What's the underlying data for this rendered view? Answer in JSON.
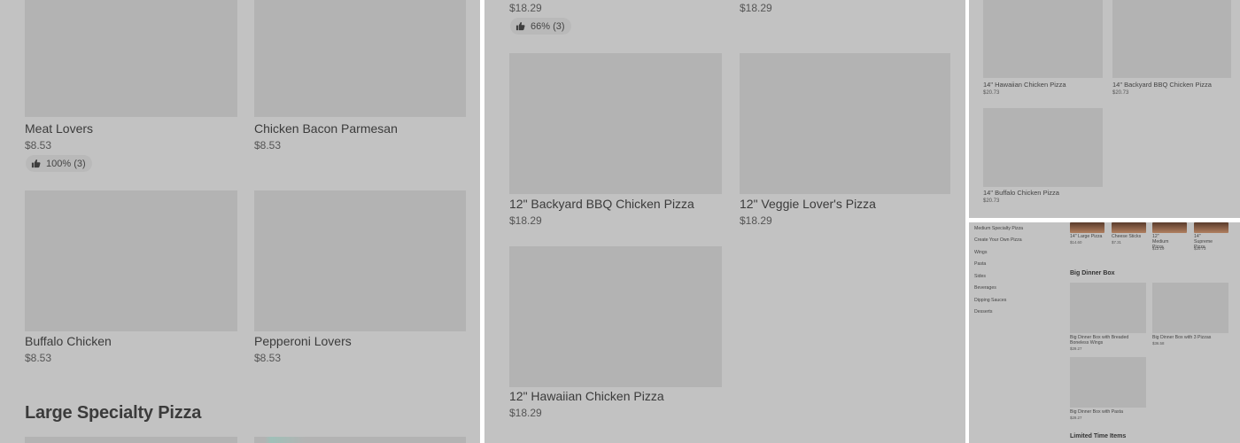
{
  "panel_1": {
    "items": [
      {
        "name": "Meat Lovers",
        "price": "$8.53",
        "rating": "100% (3)"
      },
      {
        "name": "Chicken Bacon Parmesan",
        "price": "$8.53"
      },
      {
        "name": "Buffalo Chicken",
        "price": "$8.53"
      },
      {
        "name": "Pepperoni Lovers",
        "price": "$8.53"
      }
    ],
    "section_title": "Large Specialty Pizza"
  },
  "panel_2": {
    "top_prices": [
      "$18.29",
      "$18.29"
    ],
    "top_rating": "66% (3)",
    "items": [
      {
        "name": "12\" Backyard BBQ Chicken Pizza",
        "price": "$18.29"
      },
      {
        "name": "12\" Veggie Lover's Pizza",
        "price": "$18.29"
      },
      {
        "name": "12\" Hawaiian Chicken Pizza",
        "price": "$18.29"
      }
    ]
  },
  "panel_3": {
    "items": [
      {
        "name": "14\" Hawaiian Chicken Pizza",
        "price": "$20.73"
      },
      {
        "name": "14\" Backyard BBQ Chicken Pizza",
        "price": "$20.73"
      },
      {
        "name": "14\" Buffalo Chicken Pizza",
        "price": "$20.73"
      }
    ]
  },
  "panel_4": {
    "sidebar": [
      "Medium Specialty Pizza",
      "Create Your Own Pizza",
      "Wings",
      "Pasta",
      "Sides",
      "Beverages",
      "Dipping Sauces",
      "Desserts"
    ],
    "featured": [
      {
        "name": "14\" Large Pizza",
        "price": "$14.60"
      },
      {
        "name": "Cheese Sticks",
        "price": "$7.31"
      },
      {
        "name": "12\" Medium Pizza",
        "price": "$12.19"
      },
      {
        "name": "14\" Supreme Pizza",
        "price": "$20.73"
      }
    ],
    "section_big_dinner": "Big Dinner Box",
    "dinner_items": [
      {
        "name": "Big Dinner Box with Breaded Boneless Wings",
        "price": "$29.27"
      },
      {
        "name": "Big Dinner Box with 3 Pizzas",
        "price": "$36.58"
      },
      {
        "name": "Big Dinner Box with Pasta",
        "price": "$29.27"
      }
    ],
    "section_limited": "Limited Time Items"
  },
  "icons": {
    "rating": "thumbs-up-icon"
  },
  "colors": {
    "background": "#c2c2c2",
    "image_placeholder": "#b3b3b3",
    "badge": "#b9b9b9",
    "divider": "#ffffff"
  }
}
